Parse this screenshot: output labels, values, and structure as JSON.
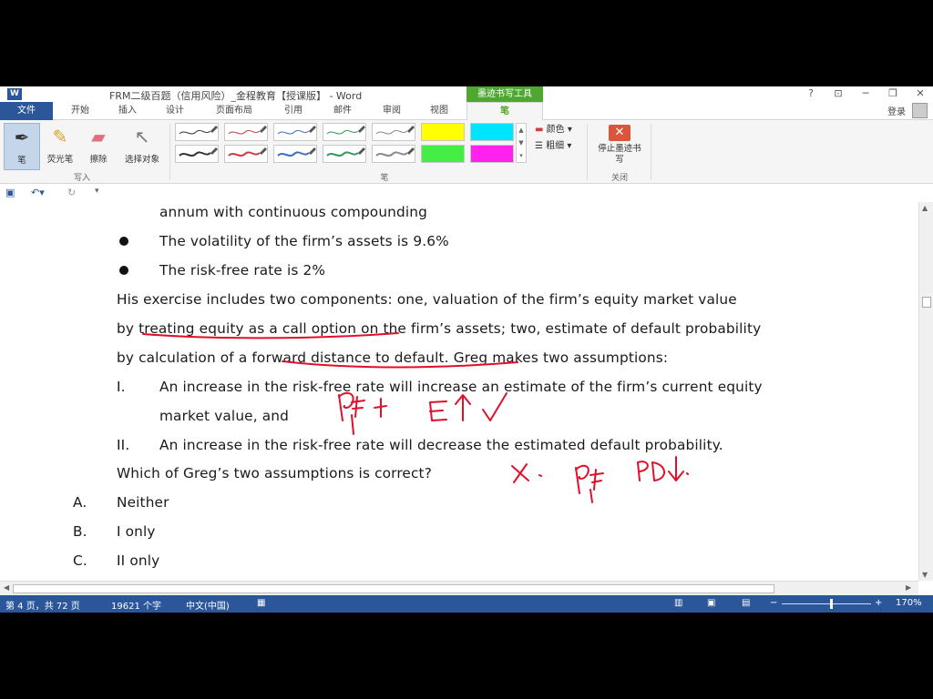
{
  "titlebar": {
    "app_icon_letter": "W",
    "title": "FRM二级百题（信用风险）_金程教育【授课版】 - Word",
    "context_tab_group": "墨迹书写工具",
    "help": "?",
    "ribbon_display": "⊡",
    "minimize": "─",
    "restore": "❐",
    "close": "✕"
  },
  "tabs": {
    "file": "文件",
    "items": [
      "开始",
      "插入",
      "设计",
      "页面布局",
      "引用",
      "邮件",
      "审阅",
      "视图"
    ],
    "active": "笔",
    "login": "登录"
  },
  "ribbon": {
    "write_group": {
      "label": "写入",
      "pen": "笔",
      "highlighter": "荧光笔",
      "eraser": "擦除",
      "select_objects": "选择对象"
    },
    "pens_group": {
      "label": "笔",
      "color_option": "颜色",
      "thickness_option": "粗细",
      "pen_colors": [
        "#333333",
        "#d03b3b",
        "#3b6fc0",
        "#2e9b57",
        "#888888"
      ],
      "highlighter_colors": [
        "#ffff00",
        "#00e5ff",
        "#44ee44",
        "#ff22ee"
      ]
    },
    "close_group": {
      "label": "关闭",
      "stop_inking": "停止墨迹书写"
    }
  },
  "qat": {
    "save_icon": "save-icon",
    "undo_icon": "undo-icon",
    "redo_icon": "redo-icon",
    "customize_icon": "customize-icon"
  },
  "document": {
    "lines": [
      "annum with continuous compounding",
      "The volatility of the firm’s assets is 9.6%",
      "The risk-free rate is 2%",
      "His exercise includes two components: one, valuation of the firm’s equity market value",
      "by treating equity as a call option on the firm’s assets; two, estimate of default probability",
      "by calculation of a forward distance to default. Greg makes two assumptions:",
      "I.",
      "An increase in the risk-free rate will increase an estimate of the firm’s current equity",
      "market value, and",
      "II.",
      "An increase in the risk-free rate will decrease the estimated default probability.",
      "Which of Greg’s two assumptions is correct?",
      "A.",
      "Neither",
      "B.",
      "I only",
      "C.",
      "II only"
    ],
    "ink_color": "#e0102a"
  },
  "status": {
    "page": "第 4 页，共 72 页",
    "words": "19621 个字",
    "language": "中文(中国)",
    "zoom_minus": "−",
    "zoom_plus": "+",
    "zoom": "170%",
    "zoom_level": 0.55
  }
}
